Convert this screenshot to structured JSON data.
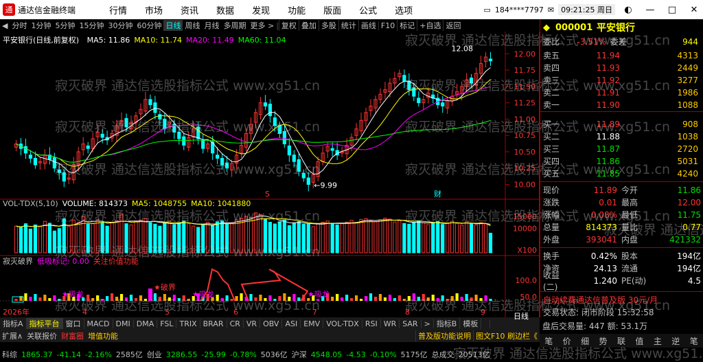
{
  "app": {
    "title": "通达信金融终端"
  },
  "menu": [
    "行情",
    "市场",
    "资讯",
    "数据",
    "发现",
    "功能",
    "版面",
    "公式",
    "选项"
  ],
  "account": "184****7797",
  "clock": "09:21:25 周日",
  "toolbar": {
    "periods": [
      "分时",
      "1分钟",
      "5分钟",
      "15分钟",
      "30分钟",
      "60分钟",
      "日线",
      "周线",
      "月线",
      "多周期",
      "更多 >"
    ],
    "tools": [
      "复权",
      "叠加",
      "多股",
      "统计",
      "画线",
      "F10",
      "标记",
      "+自选",
      "返回"
    ]
  },
  "chart_header": "平安银行(日线,前复权)",
  "ma_legend": [
    {
      "label": "MA5: 11.86",
      "color": "#ffffff"
    },
    {
      "label": "MA10: 11.74",
      "color": "#ffff00"
    },
    {
      "label": "MA20: 11.49",
      "color": "#ff00ff"
    },
    {
      "label": "MA60: 11.04",
      "color": "#00ff00"
    }
  ],
  "vol_legend": [
    {
      "label": "VOL-TDX(5,10)",
      "color": "#c0c0c0"
    },
    {
      "label": "VOLUME: 814373",
      "color": "#ffffff"
    },
    {
      "label": "MA5: 1048755",
      "color": "#ffff00"
    },
    {
      "label": "MA10: 1041880",
      "color": "#ffff00"
    }
  ],
  "ind_legend": [
    {
      "label": "寂灭破界",
      "color": "#c0c0c0"
    },
    {
      "label": "低吸标记: 0.00",
      "color": "#ff00ff"
    },
    {
      "label": "关注价值功能",
      "color": "#ff3333"
    }
  ],
  "price_axis": [
    "12.00",
    "11.75",
    "11.50",
    "11.25",
    "11.00",
    "10.75",
    "10.50",
    "10.25",
    "10.00"
  ],
  "vol_axis": [
    "15000",
    "10000",
    "X100"
  ],
  "ind_axis": [
    "100.0",
    "50.0"
  ],
  "price_high_label": "12.08",
  "price_low_label": "9.99",
  "xaxis": [
    "2026年",
    "4",
    "5",
    "6",
    "7",
    "8",
    "9"
  ],
  "chart_markers": {
    "s": "S",
    "cai": "财",
    "pojie": "破界",
    "xilong": "吸龙"
  },
  "quote": {
    "code": "000001",
    "name": "平安银行",
    "weibi_label": "委比",
    "weibi": "-3.51%",
    "weicha_label": "委差",
    "weicha": "944",
    "asks": [
      {
        "label": "卖五",
        "price": "11.94",
        "vol": "4313"
      },
      {
        "label": "卖四",
        "price": "11.93",
        "vol": "2449"
      },
      {
        "label": "卖三",
        "price": "11.92",
        "vol": "3277"
      },
      {
        "label": "卖二",
        "price": "11.91",
        "vol": "1986"
      },
      {
        "label": "卖一",
        "price": "11.90",
        "vol": "1088"
      }
    ],
    "bids": [
      {
        "label": "买一",
        "price": "11.89",
        "vol": "908",
        "color": "#ff3333"
      },
      {
        "label": "买二",
        "price": "11.88",
        "vol": "1038",
        "color": "#ffffff"
      },
      {
        "label": "买三",
        "price": "11.87",
        "vol": "2720",
        "color": "#00e000"
      },
      {
        "label": "买四",
        "price": "11.86",
        "vol": "5031",
        "color": "#00e000"
      },
      {
        "label": "买五",
        "price": "11.85",
        "vol": "4240",
        "color": "#00e000"
      }
    ],
    "stats": [
      {
        "l1": "现价",
        "v1": "11.89",
        "c1": "#ff3333",
        "l2": "今开",
        "v2": "11.86",
        "c2": "#00e000"
      },
      {
        "l1": "涨跌",
        "v1": "0.01",
        "c1": "#ff3333",
        "l2": "最高",
        "v2": "12.00",
        "c2": "#ff3333"
      },
      {
        "l1": "涨幅",
        "v1": "0.08%",
        "c1": "#ff3333",
        "l2": "最低",
        "v2": "11.75",
        "c2": "#00e000"
      },
      {
        "l1": "总量",
        "v1": "814373",
        "c1": "#ffff00",
        "l2": "量比",
        "v2": "0.77",
        "c2": "#ffff00"
      },
      {
        "l1": "外盘",
        "v1": "393041",
        "c1": "#ff3333",
        "l2": "内盘",
        "v2": "421332",
        "c2": "#00e000"
      },
      {
        "l1": "换手",
        "v1": "0.42%",
        "c1": "#ffffff",
        "l2": "股本",
        "v2": "194亿",
        "c2": "#ffffff"
      },
      {
        "l1": "净资",
        "v1": "24.13",
        "c1": "#ffffff",
        "l2": "流通",
        "v2": "194亿",
        "c2": "#ffffff"
      },
      {
        "l1": "收益(二)",
        "v1": "1.240",
        "c1": "#ffffff",
        "l2": "PE(动)",
        "v2": "4.5",
        "c2": "#ffffff"
      }
    ],
    "ad": "自动续费通达信普及版 30元/月",
    "trade_state": "交易状态: 闭市阶段 15:32:58",
    "after_hours": "盘后交易量: 447 额: 53.1万"
  },
  "rp_icons": [
    "笔",
    "价",
    "细",
    "势",
    "联",
    "值",
    "主",
    "逆",
    "笔"
  ],
  "bottom_tabs1": [
    "指标A",
    "指标平台",
    "窗口",
    "MACD",
    "DMI",
    "DMA",
    "FSL",
    "TRIX",
    "BRAR",
    "CR",
    "VR",
    "OBV",
    "ASI",
    "EMV",
    "VOL-TDX",
    "RSI",
    "WR",
    "SAR",
    ">",
    "指标B",
    "模板",
    " "
  ],
  "bottom_tabs2": [
    "扩展∧",
    "关联报价",
    "财富圈",
    "增值功能"
  ],
  "bottom_right2": [
    "普及版功能说明",
    "图文F10 刷边栏《"
  ],
  "day_label": "日线",
  "status_bar": [
    {
      "t": "科综",
      "c": "#c0c0c0"
    },
    {
      "t": "1865.37",
      "c": "#00e000"
    },
    {
      "t": "-41.14",
      "c": "#00e000"
    },
    {
      "t": "-2.16%",
      "c": "#00e000"
    },
    {
      "t": "2585亿",
      "c": "#c0c0c0"
    },
    {
      "t": "创业",
      "c": "#c0c0c0"
    },
    {
      "t": "3286.55",
      "c": "#00e000"
    },
    {
      "t": "-25.99",
      "c": "#00e000"
    },
    {
      "t": "-0.78%",
      "c": "#00e000"
    },
    {
      "t": "5036亿",
      "c": "#c0c0c0"
    },
    {
      "t": "沪深",
      "c": "#c0c0c0"
    },
    {
      "t": "4548.05",
      "c": "#00e000"
    },
    {
      "t": "-4.53",
      "c": "#00e000"
    },
    {
      "t": "-0.10%",
      "c": "#00e000"
    },
    {
      "t": "5175亿",
      "c": "#c0c0c0"
    },
    {
      "t": "总成交",
      "c": "#c0c0c0"
    },
    {
      "t": "20513亿",
      "c": "#c0c0c0"
    }
  ],
  "watermark": "寂灭破界 通达信选股指标公式 www.xg51.cn",
  "colors": {
    "up": "#ff3333",
    "down": "#00ffff",
    "ma5": "#ffffff",
    "ma10": "#ffff00",
    "ma20": "#ff00ff",
    "ma60": "#00ff00"
  },
  "chart_data": {
    "type": "candlestick",
    "ylim": [
      9.9,
      12.15
    ],
    "closes": [
      10.62,
      10.55,
      10.48,
      10.4,
      10.3,
      10.35,
      10.45,
      10.38,
      10.25,
      10.18,
      10.05,
      10.1,
      10.3,
      10.5,
      10.62,
      10.55,
      10.7,
      10.8,
      10.72,
      10.68,
      10.78,
      10.9,
      10.98,
      10.88,
      10.95,
      11.05,
      11.15,
      11.3,
      11.22,
      11.1,
      11.0,
      10.85,
      10.95,
      10.8,
      10.7,
      10.6,
      10.72,
      10.85,
      10.7,
      10.55,
      10.62,
      10.48,
      10.4,
      10.3,
      10.25,
      10.32,
      10.45,
      10.6,
      10.78,
      10.92,
      11.1,
      11.25,
      11.2,
      11.05,
      10.9,
      10.78,
      10.62,
      10.45,
      10.35,
      10.2,
      10.1,
      10.0,
      10.15,
      10.35,
      10.48,
      10.58,
      10.52,
      10.45,
      10.5,
      10.6,
      10.72,
      10.85,
      10.98,
      11.1,
      11.2,
      11.3,
      11.38,
      11.45,
      11.55,
      11.62,
      11.7,
      11.58,
      11.45,
      11.35,
      11.25,
      11.3,
      11.4,
      11.32,
      11.22,
      11.2,
      11.28,
      11.35,
      11.42,
      11.5,
      11.6,
      11.55,
      11.7,
      11.85,
      11.95,
      11.89
    ],
    "volumes": [
      11000,
      10500,
      12000,
      9800,
      11500,
      10800,
      13000,
      12200,
      9000,
      10000,
      14000,
      11000,
      13500,
      12500,
      15000,
      11800,
      12000,
      13800,
      12500,
      11000,
      12600,
      13200,
      15800,
      12000,
      11500,
      12800,
      13500,
      14000,
      12500,
      11800,
      11000,
      12400,
      13000,
      11600,
      12200,
      13100,
      12000,
      11000,
      10500,
      11800,
      12600,
      11300,
      12800,
      13200,
      11900,
      12400,
      13600,
      14200,
      15000,
      14600,
      16500,
      15800,
      13800,
      12600,
      11900,
      12800,
      13600,
      11200,
      12300,
      12900,
      11800,
      12000,
      10800,
      11900,
      12600,
      13100,
      12200,
      11500,
      12000,
      12700,
      13400,
      12600,
      13800,
      14100,
      13200,
      12800,
      13600,
      14300,
      13900,
      12700,
      13300,
      12100,
      11800,
      12600,
      13200,
      12400,
      11600,
      12200,
      12900,
      11700,
      12300,
      13000,
      12100,
      11400,
      12800,
      12000,
      11500,
      12400,
      11900,
      8100
    ]
  }
}
